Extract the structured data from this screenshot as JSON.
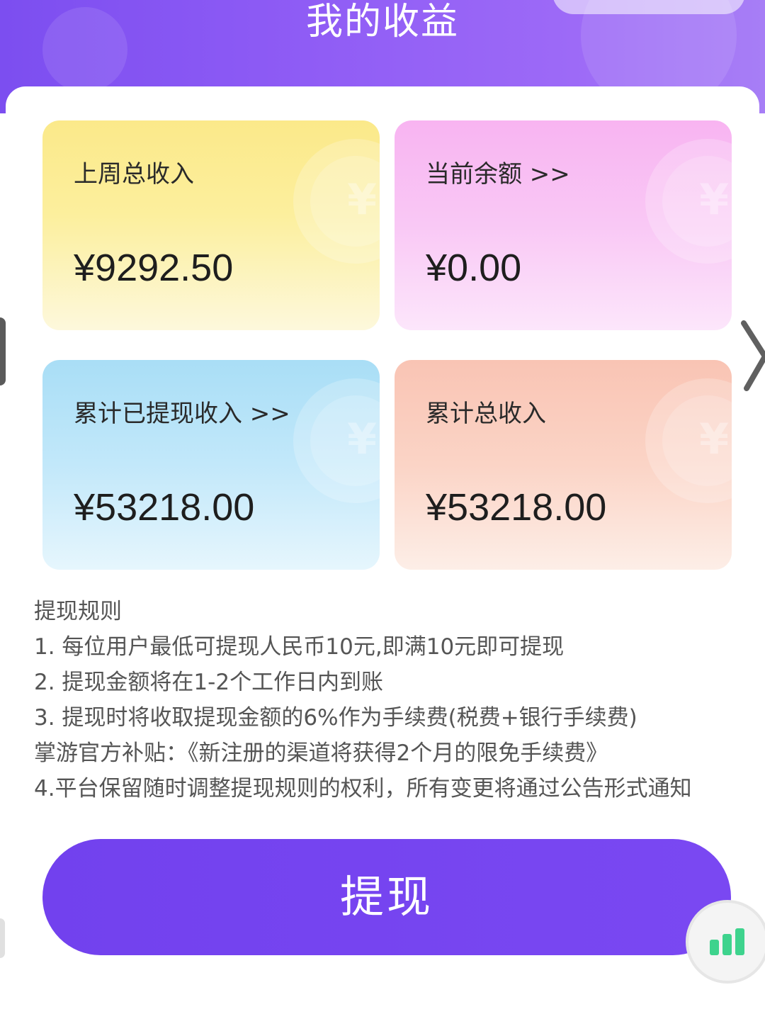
{
  "header": {
    "title": "我的收益"
  },
  "cards": [
    {
      "label": "上周总收入",
      "value": "¥9292.50"
    },
    {
      "label": "当前余额 >>",
      "value": "¥0.00"
    },
    {
      "label": "累计已提现收入 >>",
      "value": "¥53218.00"
    },
    {
      "label": "累计总收入",
      "value": "¥53218.00"
    }
  ],
  "rules": {
    "title": "提现规则",
    "lines": [
      "1. 每位用户最低可提现人民币10元,即满10元即可提现",
      "2. 提现金额将在1-2个工作日内到账",
      "3. 提现时将收取提现金额的6%作为手续费(税费+银行手续费)",
      "掌游官方补贴：《新注册的渠道将获得2个月的限免手续费》",
      "4.平台保留随时调整提现规则的权利，所有变更将通过公告形式通知"
    ]
  },
  "withdraw_button": {
    "label": "提现"
  },
  "icons": {
    "card_decoration": "yuan-coin-icon",
    "floating_button": "bar-chart-icon"
  },
  "colors": {
    "header": "#8a58f3",
    "button": "#7443ef",
    "card_yellow": "#fbe98a",
    "card_pink": "#f8b4f1",
    "card_blue": "#a9def6",
    "card_orange": "#f9c4b4",
    "chart_icon": "#3ed38d"
  }
}
